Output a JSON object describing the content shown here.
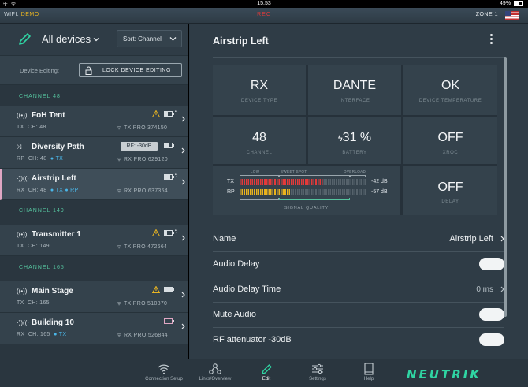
{
  "status_bar": {
    "time": "15:53",
    "battery": "49%",
    "battery_level": 0.49
  },
  "wifi_bar": {
    "wifi_prefix": "WIFI:",
    "network": "DEMO",
    "rec": "REC",
    "zone": "ZONE 1"
  },
  "left_panel": {
    "title": "All devices",
    "sort_label": "Sort: Channel",
    "device_editing_label": "Device Editing:",
    "lock_button": "LOCK DEVICE EDITING",
    "channels": [
      {
        "header": "CHANNEL 48",
        "devices": [
          {
            "icon": "((•))",
            "name": "FoH Tent",
            "role": "TX",
            "channel": "CH: 48",
            "tags": "",
            "model": "TX PRO 374150",
            "warning": true,
            "battery_level": 0.45,
            "badge": ""
          },
          {
            "icon": "⤨",
            "name": "Diversity Path",
            "role": "RP",
            "channel": "CH: 48",
            "tags": "● TX",
            "model": "RX PRO 629120",
            "warning": false,
            "battery_level": 0.5,
            "badge": "RF: -30dB"
          },
          {
            "icon": "·))((·",
            "name": "Airstrip Left",
            "role": "RX",
            "channel": "CH: 48",
            "tags": "● TX  ● RP",
            "model": "RX PRO 637354",
            "warning": false,
            "battery_level": 0.8,
            "badge": "",
            "selected": true
          }
        ]
      },
      {
        "header": "CHANNEL 149",
        "devices": [
          {
            "icon": "((•))",
            "name": "Transmitter 1",
            "role": "TX",
            "channel": "CH: 149",
            "tags": "",
            "model": "TX PRO 472664",
            "warning": true,
            "battery_level": 0.35,
            "badge": ""
          }
        ]
      },
      {
        "header": "CHANNEL 165",
        "devices": [
          {
            "icon": "((•))",
            "name": "Main Stage",
            "role": "TX",
            "channel": "CH: 165",
            "tags": "",
            "model": "TX PRO 510870",
            "warning": true,
            "battery_level": 1.0,
            "badge": ""
          },
          {
            "icon": "·))((·",
            "name": "Building 10",
            "role": "RX",
            "channel": "CH: 165",
            "tags": "● TX",
            "model": "RX PRO 526844",
            "warning": false,
            "battery_level": 0.0,
            "badge": ""
          }
        ]
      }
    ]
  },
  "right_panel": {
    "title": "Airstrip Left",
    "tiles": [
      {
        "value": "RX",
        "label": "DEVICE TYPE"
      },
      {
        "value": "DANTE",
        "label": "INTERFACE"
      },
      {
        "value": "OK",
        "label": "DEVICE TEMPERATURE"
      },
      {
        "value": "48",
        "label": "CHANNEL"
      },
      {
        "value": "31 %",
        "label": "BATTERY"
      },
      {
        "value": "OFF",
        "label": "XROC"
      },
      {
        "value": "OFF",
        "label": "DELAY"
      }
    ],
    "signal_quality": {
      "caption": "SIGNAL QUALITY",
      "zone_low": "LOW",
      "zone_sweet": "SWEET SPOT",
      "zone_overload": "OVERLOAD",
      "tx": {
        "label": "TX",
        "value": "-42 dB",
        "level": 0.66,
        "color": "#e23a3a"
      },
      "rp": {
        "label": "RP",
        "value": "-57 dB",
        "level": 0.4,
        "color": "#e9b21e"
      }
    },
    "settings": [
      {
        "label": "Name",
        "value": "Airstrip Left",
        "kind": "link"
      },
      {
        "label": "Audio Delay",
        "value": "",
        "kind": "toggle"
      },
      {
        "label": "Audio Delay Time",
        "value": "0 ms",
        "kind": "link"
      },
      {
        "label": "Mute Audio",
        "value": "",
        "kind": "toggle"
      },
      {
        "label": "RF attenuator -30dB",
        "value": "",
        "kind": "toggle"
      }
    ]
  },
  "tab_bar": {
    "tabs": [
      {
        "label": "Connection Setup",
        "icon": "wifi-icon"
      },
      {
        "label": "Links/Overview",
        "icon": "network-icon"
      },
      {
        "label": "Edit",
        "icon": "pencil-icon",
        "active": true
      },
      {
        "label": "Settings",
        "icon": "sliders-icon"
      },
      {
        "label": "Help",
        "icon": "book-icon"
      }
    ],
    "logo": "NEUTRIK"
  },
  "colors": {
    "accent": "#2fd5a3",
    "channel_header": "#55c39e",
    "warning": "#e8b422",
    "selected_marker": "#e0a7c4"
  }
}
